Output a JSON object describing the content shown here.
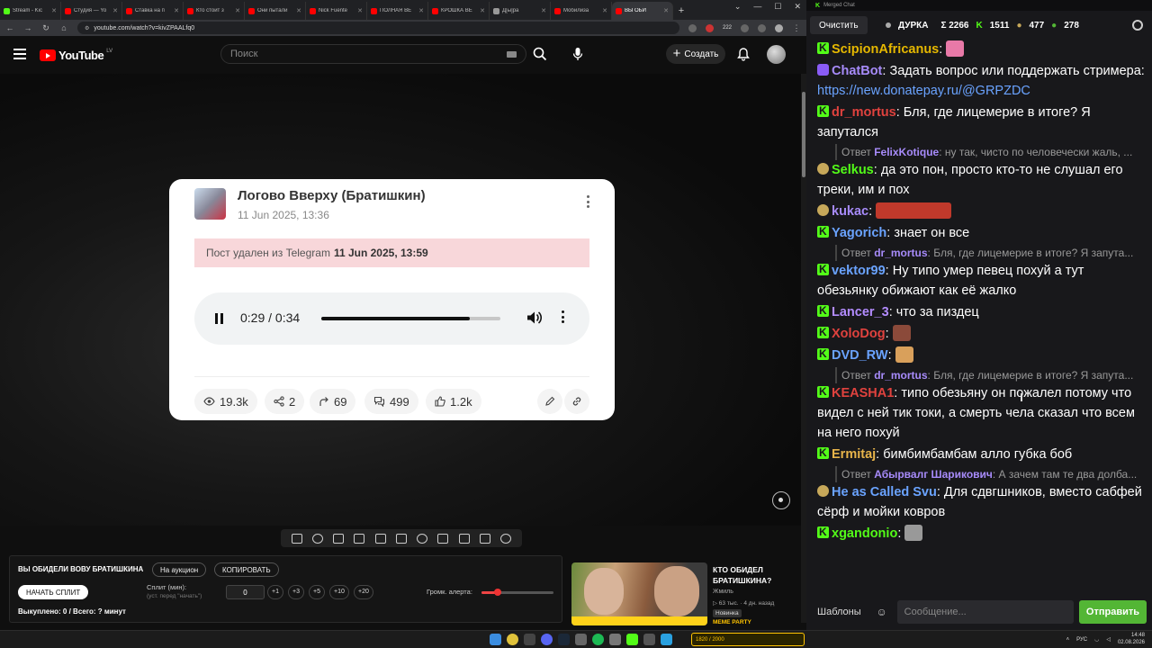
{
  "browser": {
    "tabs": [
      {
        "label": "Stream - Kic",
        "color": "#53fc18"
      },
      {
        "label": "Студия — Yo",
        "color": "#ff0000"
      },
      {
        "label": "Ставка на п",
        "color": "#ff0000"
      },
      {
        "label": "Кто стоит з",
        "color": "#ff0000"
      },
      {
        "label": "Они пытали",
        "color": "#ff0000"
      },
      {
        "label": "Nick Fuente",
        "color": "#ff0000"
      },
      {
        "label": "ПОЛНАЯ ВЕ",
        "color": "#ff0000"
      },
      {
        "label": "КРОШКА ВЕ",
        "color": "#ff0000"
      },
      {
        "label": "Д[ы]ра",
        "color": "#999999"
      },
      {
        "label": "Мобилиза",
        "color": "#ff0000"
      },
      {
        "label": "ВЫ ОБИ",
        "color": "#ff0000",
        "active": true
      }
    ],
    "url": "youtube.com/watch?v=kivZPAALfq0",
    "ext_badge": "222"
  },
  "youtube": {
    "logo_text": "YouTube",
    "logo_region": "LV",
    "search_placeholder": "Поиск",
    "create_label": "Создать"
  },
  "card": {
    "title": "Логово Вверху (Братишкин)",
    "date": "11 Jun 2025, 13:36",
    "deleted_prefix": "Пост удален из Telegram",
    "deleted_date": "11 Jun 2025, 13:59",
    "audio_time": "0:29 / 0:34",
    "audio_progress": 0.83,
    "stats": {
      "views": "19.3k",
      "shares": "2",
      "forwards": "69",
      "comments": "499",
      "likes": "1.2k"
    }
  },
  "panel": {
    "title": "ВЫ ОБИДЕЛИ ВОВУ БРАТИШКИНА",
    "auction_btn": "На аукцион",
    "copy_btn": "КОПИРОВАТЬ",
    "start_split": "НАЧАТЬ СПЛИТ",
    "split_label": "Сплит (мин):",
    "split_sub": "(уст. перед \"начать\")",
    "split_value": "0",
    "inc_buttons": [
      "+1",
      "+3",
      "+5",
      "+10",
      "+20"
    ],
    "alert_label": "Громк. алерта:",
    "alert_volume": 0.22,
    "bought": "Выкуплено: 0 / Всего: ? минут"
  },
  "recommendation": {
    "title": "КТО ОБИДЕЛ БРАТИШКИНА?",
    "channel": "Жмиль",
    "meta": "▷ 63 тыс.  · 4 дн. назад",
    "badge": "Новинка",
    "meme_text": "MEME PARTY"
  },
  "chat": {
    "window_title": "Merged Chat",
    "clear_label": "Очистить",
    "channel_name": "ДУРКА",
    "total_count": "Σ 2266",
    "kick_count": "1511",
    "twitch_count": "477",
    "other_count": "278",
    "templates_label": "Шаблоны",
    "input_placeholder": "Сообщение...",
    "send_label": "Отправить",
    "messages": [
      {
        "badge": "k",
        "user": "ScipionAfricanus",
        "color": "#e6b800",
        "text": "",
        "emote": "#e879a8"
      },
      {
        "badge": "bot",
        "user": "ChatBot",
        "color": "#a78bfa",
        "text": "Задать вопрос или поддержать стримера: ",
        "link": "https://new.donatepay.ru/@GRPZDC"
      },
      {
        "badge": "k",
        "user": "dr_mortus",
        "color": "#e0423e",
        "text": "Бля, где лицемерие в итоге? Я запутался",
        "reply_user": "",
        "reply_text": ""
      },
      {
        "reply_user": "FelixKotique",
        "reply_text": "ну так, чисто по человечески жаль, ..."
      },
      {
        "badge": "b",
        "user": "Selkus",
        "color": "#53fc18",
        "text": "да это пон, просто кто-то не слушал его треки, им и пох"
      },
      {
        "badge": "b",
        "user": "kukac",
        "color": "#a78bfa",
        "text": "",
        "emote": "#c0392b"
      },
      {
        "badge": "k",
        "user": "Yagorich",
        "color": "#6aa3ff",
        "text": "знает он все"
      },
      {
        "reply_user": "dr_mortus",
        "reply_text": "Бля, где лицемерие в итоге? Я запута..."
      },
      {
        "badge": "k",
        "user": "vektor99",
        "color": "#6aa3ff",
        "text": "Ну типо умер певец похуй а тут обезьянку обижают как её жалко"
      },
      {
        "badge": "k",
        "user": "Lancer_3",
        "color": "#b38cff",
        "text": "что за пиздец"
      },
      {
        "badge": "k",
        "user": "XoloDog",
        "color": "#e0423e",
        "text": "",
        "emote": "#8b4a3a"
      },
      {
        "badge": "k",
        "user": "DVD_RW",
        "color": "#6aa3ff",
        "text": "",
        "emote": "#d9a05b"
      },
      {
        "reply_user": "dr_mortus",
        "reply_text": "Бля, где лицемерие в итоге? Я запута..."
      },
      {
        "badge": "k",
        "user": "KEASHA1",
        "color": "#e0423e",
        "text": "типо обезьяну он пожалел потому что видел с ней тик токи, а смерть чела сказал что всем на него похуй"
      },
      {
        "badge": "k",
        "user": "Ermitaj",
        "color": "#e6b34a",
        "text": "бимбимбамбам алло губка боб"
      },
      {
        "reply_user": "Абырвалг Шарикович",
        "reply_text": "А зачем там те два долба..."
      },
      {
        "badge": "b",
        "user": "He as Called Svu",
        "color": "#6aa3ff",
        "text": "Для сдвгшников, вместо сабфей сёрф и мойки ковров"
      },
      {
        "badge": "k",
        "user": "xgandonio",
        "color": "#53fc18",
        "text": "",
        "emote": "#999999"
      }
    ]
  },
  "taskbar": {
    "lang": "РУС",
    "time": "14:48",
    "date": "02.08.2026",
    "widget_text": "1820 / 2000"
  },
  "colors": {
    "kick_green": "#53fc18",
    "yt_red": "#ff0000",
    "deleted_bg": "#f8d7da",
    "send_green": "#53b635"
  }
}
